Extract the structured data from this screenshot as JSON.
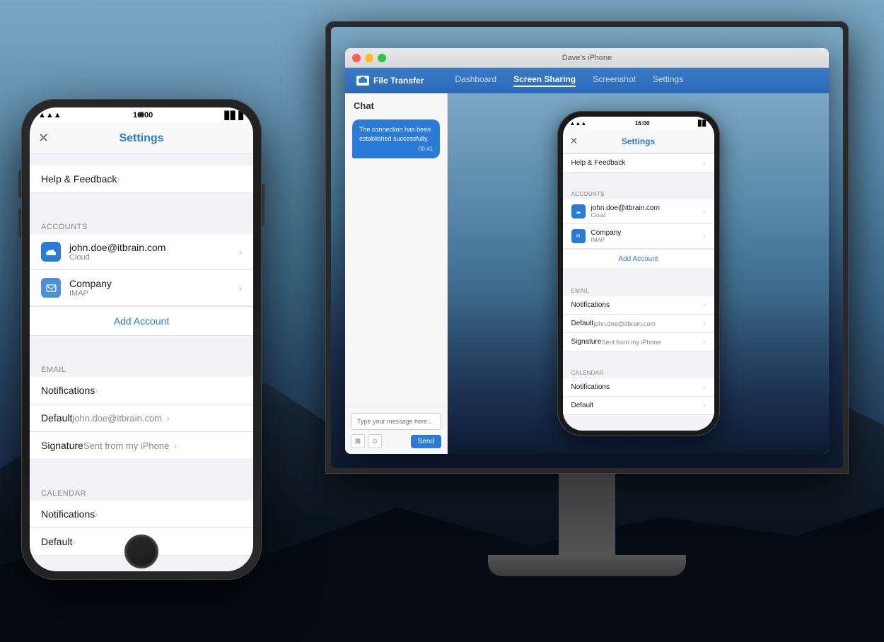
{
  "background": {
    "type": "mountain-scene"
  },
  "monitor": {
    "title": "Dave's iPhone",
    "dots": [
      "red",
      "yellow",
      "green"
    ],
    "toolbar": {
      "brand": "File Transfer",
      "nav_items": [
        {
          "label": "Dashboard",
          "active": false
        },
        {
          "label": "Screen Sharing",
          "active": true
        },
        {
          "label": "Screenshot",
          "active": false
        },
        {
          "label": "Settings",
          "active": false
        }
      ]
    },
    "chat": {
      "header": "Chat",
      "messages": [
        {
          "text": "The connection has been established successfully.",
          "time": "00:41"
        }
      ],
      "input_placeholder": "Type your message here...",
      "send_button": "Send"
    }
  },
  "iphone_in_monitor": {
    "status_bar": {
      "time": "16:00",
      "signal": "●●●",
      "battery": "■■■"
    },
    "nav": {
      "title": "Settings",
      "close_icon": "✕"
    },
    "help_feedback": "Help & Feedback",
    "accounts_header": "Accounts",
    "accounts": [
      {
        "email": "john.doe@itbrain.com",
        "type": "Cloud",
        "icon": "cloud"
      },
      {
        "email": "Company",
        "type": "IMAP",
        "icon": "mail"
      }
    ],
    "add_account": "Add Account",
    "email_header": "Email",
    "email_items": [
      {
        "label": "Notifications",
        "value": ""
      },
      {
        "label": "Default",
        "value": "john.doe@itbrain.com"
      },
      {
        "label": "Signature",
        "value": "Sent from my iPhone"
      }
    ],
    "calendar_header": "Calendar",
    "calendar_items": [
      {
        "label": "Notifications",
        "value": ""
      },
      {
        "label": "Default",
        "value": ""
      }
    ]
  },
  "iphone": {
    "status_bar": {
      "time": "16:00",
      "signal": "●●●",
      "battery": "■■■"
    },
    "nav": {
      "title": "Settings",
      "close_icon": "✕"
    },
    "help_feedback": "Help & Feedback",
    "accounts_header": "Accounts",
    "accounts": [
      {
        "email": "john.doe@itbrain.com",
        "type": "Cloud",
        "icon": "cloud"
      },
      {
        "email": "Company",
        "type": "IMAP",
        "icon": "mail"
      }
    ],
    "add_account": "Add Account",
    "email_header": "Email",
    "email_items": [
      {
        "label": "Notifications",
        "value": ""
      },
      {
        "label": "Default",
        "value": "john.doe@itbrain.com"
      },
      {
        "label": "Signature",
        "value": "Sent from my iPhone"
      }
    ],
    "calendar_header": "Calendar",
    "calendar_items": [
      {
        "label": "Notifications",
        "value": ""
      },
      {
        "label": "Default",
        "value": ""
      }
    ]
  }
}
